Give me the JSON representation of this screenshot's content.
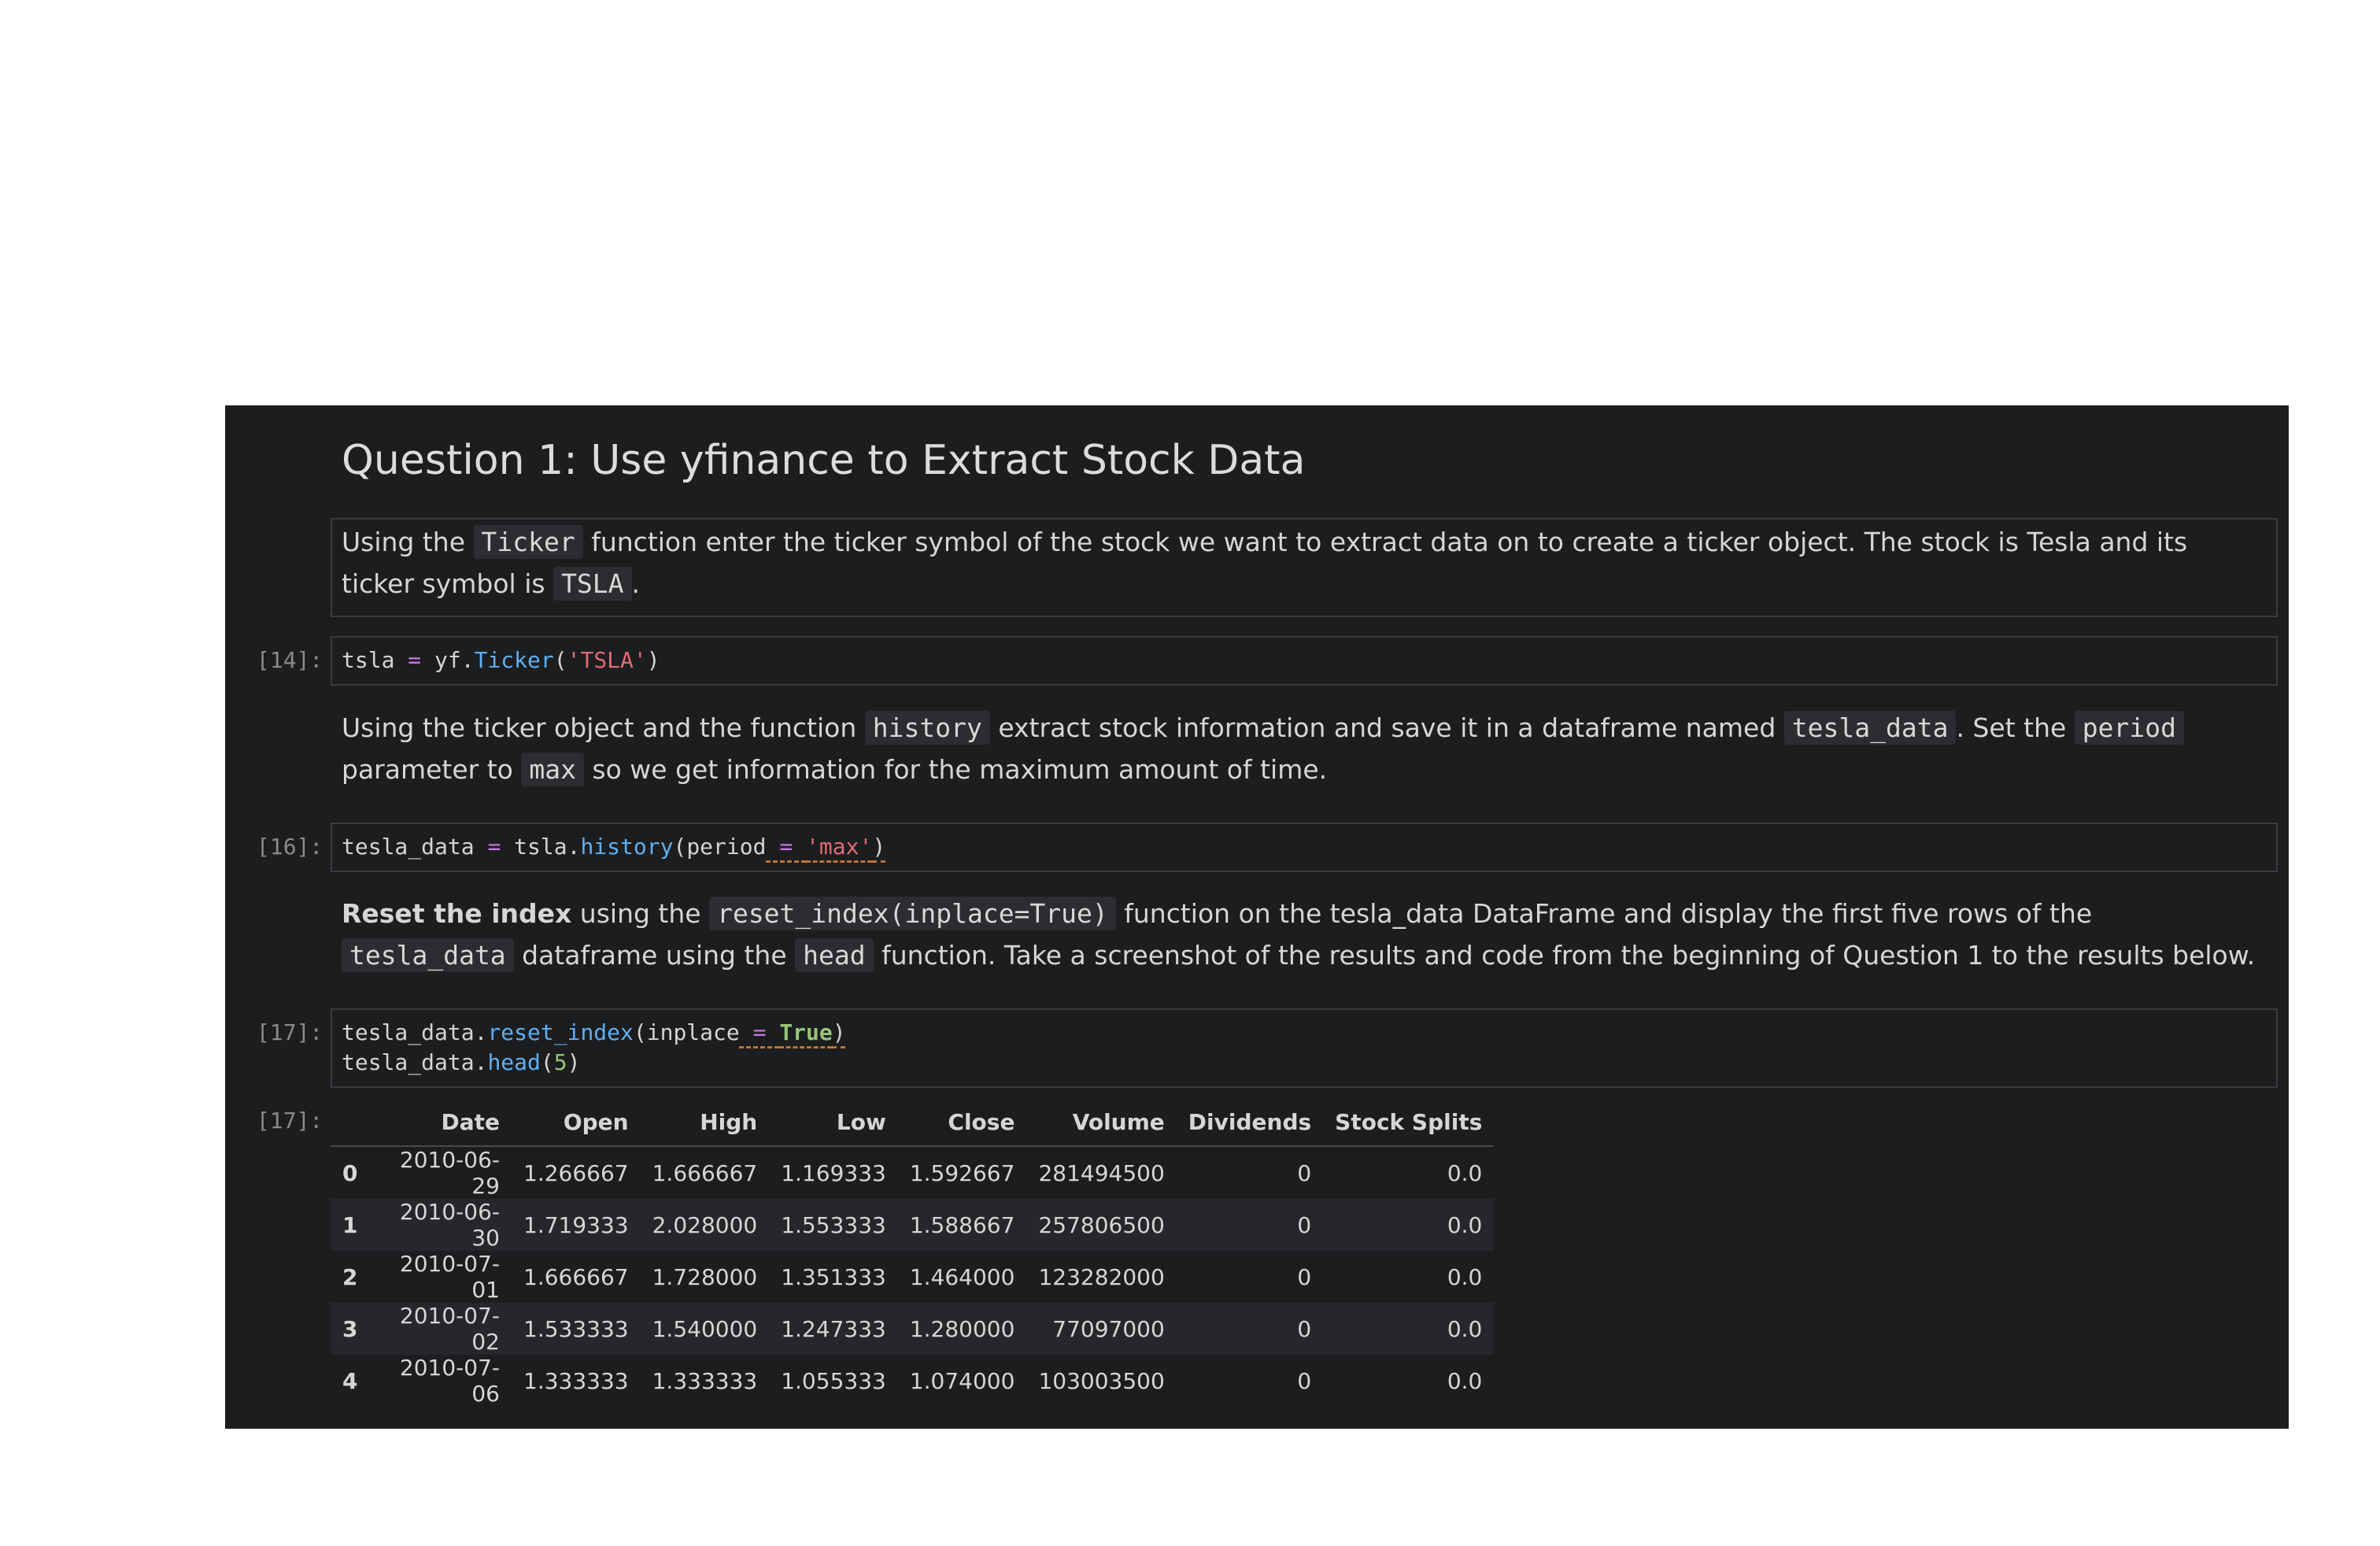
{
  "heading": "Question 1: Use yfinance to Extract Stock Data",
  "md1": {
    "p1": "Using the ",
    "c1": "Ticker",
    "p2": " function enter the ticker symbol of the stock we want to extract data on to create a ticker object. The stock is Tesla and its ticker symbol is ",
    "c2": "TSLA",
    "p3": "."
  },
  "cell14": {
    "prompt": "[14]:",
    "var": "tsla",
    "eq": "=",
    "obj": "yf.",
    "fn": "Ticker",
    "open": "(",
    "arg": "'TSLA'",
    "close": ")"
  },
  "md2": {
    "p1": "Using the ticker object and the function ",
    "c1": "history",
    "p2": " extract stock information and save it in a dataframe named ",
    "c2": "tesla_data",
    "p3": ". Set the ",
    "c3": "period",
    "p4": " parameter to ",
    "c4": "max",
    "p5": " so we get information for the maximum amount of time."
  },
  "cell16": {
    "prompt": "[16]:",
    "var": "tesla_data",
    "eq": "=",
    "obj": "tsla.",
    "fn": "history",
    "open": "(period",
    "eq2": " = ",
    "arg": "'max'",
    "close": ")"
  },
  "md3": {
    "bold": "Reset the index",
    "p1": " using the ",
    "c1": "reset_index(inplace=True)",
    "p2": " function on the tesla_data DataFrame and display the first five rows of the ",
    "c2": "tesla_data",
    "p3": " dataframe using the ",
    "c3": "head",
    "p4": " function. Take a screenshot of the results and code from the beginning of Question 1 to the results below."
  },
  "cell17": {
    "prompt": "[17]:",
    "l1_obj": "tesla_data.",
    "l1_fn": "reset_index",
    "l1_open": "(inplace",
    "l1_eq": " = ",
    "l1_arg": "True",
    "l1_close": ")",
    "l2_obj": "tesla_data.",
    "l2_fn": "head",
    "l2_open": "(",
    "l2_arg": "5",
    "l2_close": ")"
  },
  "output17": {
    "prompt": "[17]:",
    "columns": [
      "",
      "Date",
      "Open",
      "High",
      "Low",
      "Close",
      "Volume",
      "Dividends",
      "Stock Splits"
    ],
    "rows": [
      [
        "0",
        "2010-06-29",
        "1.266667",
        "1.666667",
        "1.169333",
        "1.592667",
        "281494500",
        "0",
        "0.0"
      ],
      [
        "1",
        "2010-06-30",
        "1.719333",
        "2.028000",
        "1.553333",
        "1.588667",
        "257806500",
        "0",
        "0.0"
      ],
      [
        "2",
        "2010-07-01",
        "1.666667",
        "1.728000",
        "1.351333",
        "1.464000",
        "123282000",
        "0",
        "0.0"
      ],
      [
        "3",
        "2010-07-02",
        "1.533333",
        "1.540000",
        "1.247333",
        "1.280000",
        "77097000",
        "0",
        "0.0"
      ],
      [
        "4",
        "2010-07-06",
        "1.333333",
        "1.333333",
        "1.055333",
        "1.074000",
        "103003500",
        "0",
        "0.0"
      ]
    ]
  }
}
